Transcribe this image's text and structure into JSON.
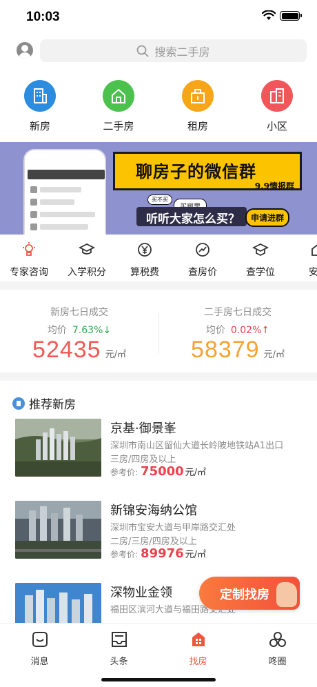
{
  "status_bar": {
    "time": "10:03"
  },
  "search": {
    "placeholder": "搜索二手房"
  },
  "categories": [
    {
      "label": "新房",
      "color": "#2c8ce0",
      "icon": "building-icon"
    },
    {
      "label": "二手房",
      "color": "#4cc14e",
      "icon": "house-icon"
    },
    {
      "label": "租房",
      "color": "#f7a519",
      "icon": "key-icon"
    },
    {
      "label": "小区",
      "color": "#f0565a",
      "icon": "community-icon"
    }
  ],
  "banner": {
    "title": "聊房子的微信群",
    "subtitle": "9.9情报群",
    "bubble_a": "买不买",
    "bubble_b": "买哪里",
    "question": "听听大家怎么买？",
    "join": "申请进群"
  },
  "tools": [
    {
      "label": "专家咨询",
      "icon": "expert-icon"
    },
    {
      "label": "入学积分",
      "icon": "graduation-icon"
    },
    {
      "label": "算税费",
      "icon": "yuan-icon"
    },
    {
      "label": "查房价",
      "icon": "price-trend-icon"
    },
    {
      "label": "查学位",
      "icon": "school-icon"
    },
    {
      "label": "安居",
      "icon": "home-icon"
    }
  ],
  "stats": {
    "new": {
      "title": "新房七日成交",
      "avg_label": "均价",
      "change": "7.63%↓",
      "price": "52435",
      "unit": "元/㎡",
      "price_color": "#ef5a55"
    },
    "second": {
      "title": "二手房七日成交",
      "avg_label": "均价",
      "change": "0.02%↑",
      "price": "58379",
      "unit": "元/㎡",
      "price_color": "#f6a232"
    }
  },
  "recommend": {
    "title": "推荐新房",
    "items": [
      {
        "name": "京基·御景峯",
        "address": "深圳市南山区留仙大道长岭陂地铁站A1出口",
        "rooms": "三房/四房及以上",
        "price_label": "参考价:",
        "price": "75000",
        "unit": "元/㎡"
      },
      {
        "name": "新锦安海纳公馆",
        "address": "深圳市宝安大道与甲岸路交汇处",
        "rooms": "二房/三房/四房及以上",
        "price_label": "参考价:",
        "price": "89976",
        "unit": "元/㎡"
      },
      {
        "name": "深物业金领",
        "address": "福田区滨河大道与福田路交汇处",
        "rooms": "",
        "price_label": "",
        "price": "",
        "unit": ""
      }
    ]
  },
  "float_button": {
    "label": "定制找房"
  },
  "tabbar": [
    {
      "label": "消息",
      "icon": "message-icon",
      "active": false
    },
    {
      "label": "头条",
      "icon": "news-icon",
      "active": false
    },
    {
      "label": "找房",
      "icon": "find-house-icon",
      "active": true
    },
    {
      "label": "咚圈",
      "icon": "circle-icon",
      "active": false
    }
  ]
}
